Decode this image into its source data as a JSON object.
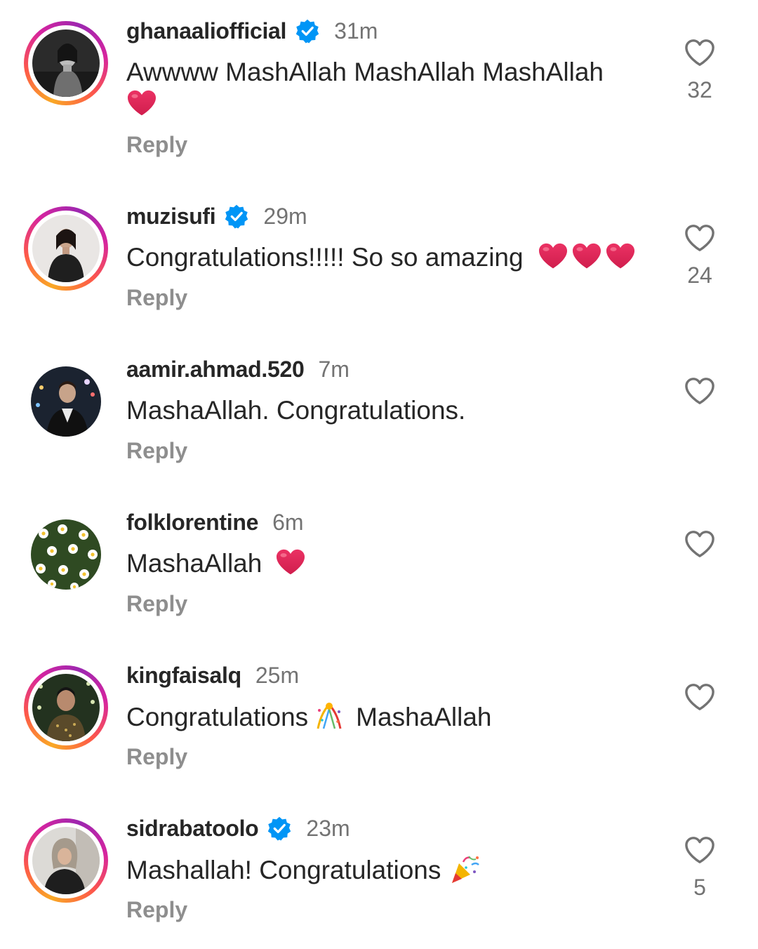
{
  "reply_label": "Reply",
  "colors": {
    "text": "#262626",
    "muted": "#737373",
    "reply": "#8e8e8e",
    "verified": "#0095f6",
    "heart_red": "#e0245e"
  },
  "comments": [
    {
      "username": "ghanaaliofficial",
      "verified": true,
      "time": "31m",
      "text": "Awwww MashAllah MashAllah MashAllah",
      "emoji": "red-heart",
      "likes": "32",
      "has_story": true
    },
    {
      "username": "muzisufi",
      "verified": true,
      "time": "29m",
      "text": "Congratulations!!!!! So so amazing",
      "emoji": "red-heart x3",
      "likes": "24",
      "has_story": true
    },
    {
      "username": "aamir.ahmad.520",
      "verified": false,
      "time": "7m",
      "text": "MashaAllah. Congratulations.",
      "likes": "",
      "has_story": false
    },
    {
      "username": "folklorentine",
      "verified": false,
      "time": "6m",
      "text": "MashaAllah",
      "emoji": "red-heart",
      "likes": "",
      "has_story": false
    },
    {
      "username": "kingfaisalq",
      "verified": false,
      "time": "25m",
      "text_before": "Congratulations",
      "emoji": "confetti-ball",
      "text_after": "MashaAllah",
      "likes": "",
      "has_story": true
    },
    {
      "username": "sidrabatoolo",
      "verified": true,
      "time": "23m",
      "text": "Mashallah! Congratulations",
      "emoji": "party-popper",
      "likes": "5",
      "has_story": true
    }
  ]
}
